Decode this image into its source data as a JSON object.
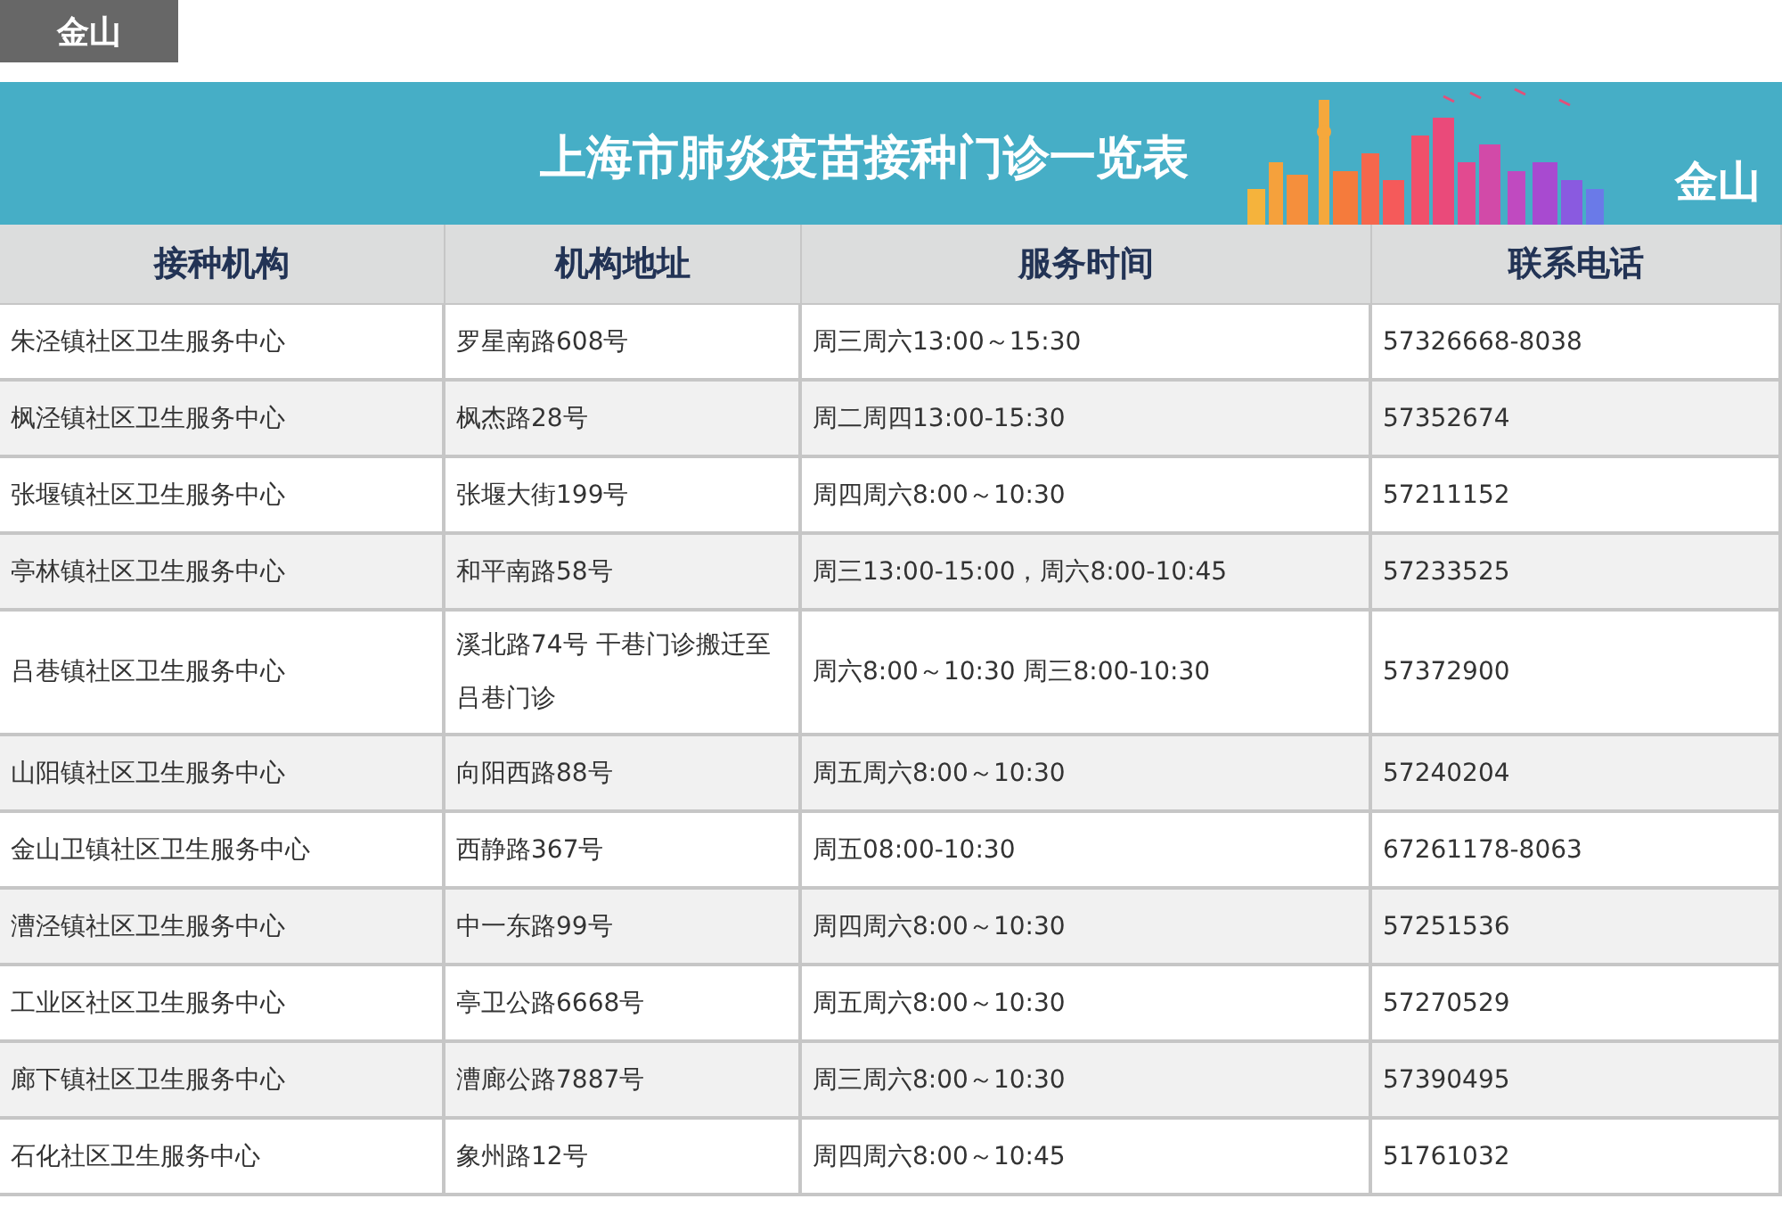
{
  "tab": {
    "label": "金山"
  },
  "banner": {
    "title": "上海市肺炎疫苗接种门诊一览表",
    "district": "金山"
  },
  "table": {
    "columns": [
      "接种机构",
      "机构地址",
      "服务时间",
      "联系电话"
    ],
    "rows": [
      [
        "朱泾镇社区卫生服务中心",
        "罗星南路608号",
        "周三周六13:00～15:30",
        "57326668-8038"
      ],
      [
        "枫泾镇社区卫生服务中心",
        "枫杰路28号",
        "周二周四13:00-15:30",
        "57352674"
      ],
      [
        "张堰镇社区卫生服务中心",
        "张堰大街199号",
        "周四周六8:00～10:30",
        "57211152"
      ],
      [
        "亭林镇社区卫生服务中心",
        "和平南路58号",
        "周三13:00-15:00，周六8:00-10:45",
        "57233525"
      ],
      [
        "吕巷镇社区卫生服务中心",
        "溪北路74号 干巷门诊搬迁至吕巷门诊",
        "周六8:00～10:30 周三8:00-10:30",
        "57372900"
      ],
      [
        "山阳镇社区卫生服务中心",
        "向阳西路88号",
        "周五周六8:00～10:30",
        "57240204"
      ],
      [
        "金山卫镇社区卫生服务中心",
        "西静路367号",
        "周五08:00-10:30",
        "67261178-8063"
      ],
      [
        "漕泾镇社区卫生服务中心",
        "中一东路99号",
        "周四周六8:00～10:30",
        "57251536"
      ],
      [
        "工业区社区卫生服务中心",
        "亭卫公路6668号",
        "周五周六8:00～10:30",
        "57270529"
      ],
      [
        "廊下镇社区卫生服务中心",
        "漕廊公路7887号",
        "周三周六8:00～10:30",
        "57390495"
      ],
      [
        "石化社区卫生服务中心",
        "象州路12号",
        "周四周六8:00～10:45",
        "51761032"
      ]
    ]
  }
}
